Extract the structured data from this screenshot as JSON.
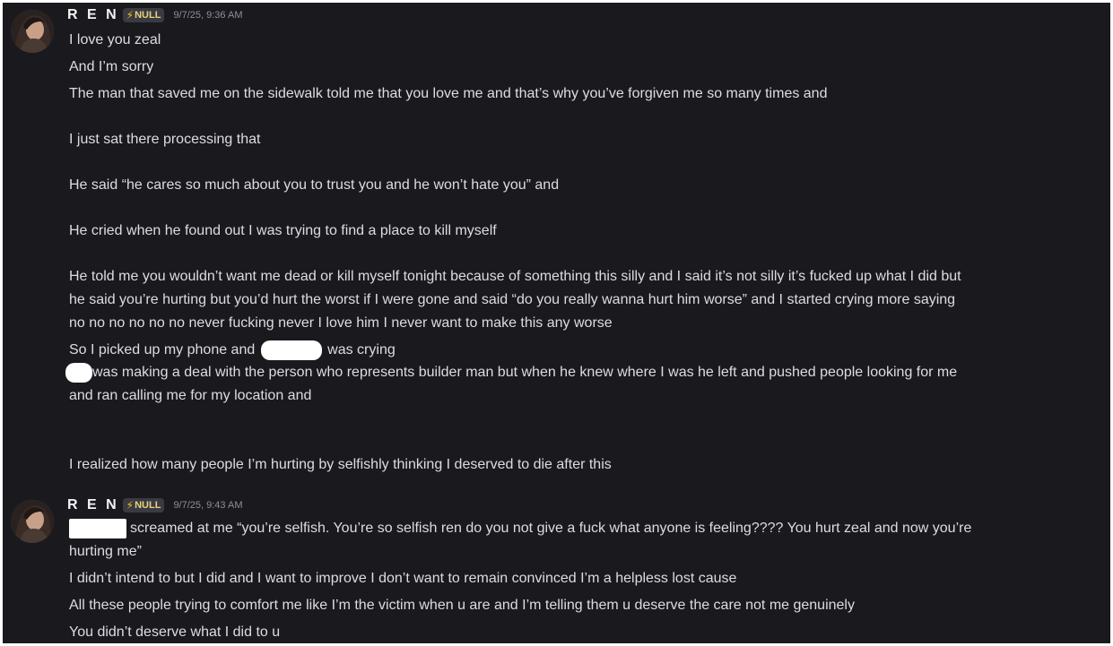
{
  "messages": [
    {
      "username": "R E N",
      "tag": "NULL",
      "tag_icon": "lightning-bolt-icon",
      "timestamp": "9/7/25, 9:36 AM",
      "lines": [
        "I love you zeal",
        "And I’m sorry",
        "The man that saved me on the sidewalk told me that you love me and that’s why you’ve forgiven me so many times and",
        "I just sat there processing that",
        "He said “he cares so much about you to trust you and he won’t hate you” and",
        "He cried when he found out I was trying to find a place to kill myself",
        "He told me you wouldn’t want me dead or kill myself tonight because of something this silly and I said it’s not silly it’s fucked up what I did but",
        "he said you’re hurting but you’d hurt the worst if I were gone and said “do you really wanna hurt him worse” and I started crying more saying",
        "no no no no no no never fucking never I love him I never want to make this any worse"
      ],
      "line_phone_before": "So I picked up my phone and",
      "line_phone_after": "was crying",
      "line_deal": "was making a deal with the person who represents builder man but when he knew where I was he left and pushed people looking for me",
      "line_ran": "and ran calling me for my location and",
      "line_realized": "I realized how many people I’m hurting by selfishly thinking I deserved to die after this"
    },
    {
      "username": "R E N",
      "tag": "NULL",
      "tag_icon": "lightning-bolt-icon",
      "timestamp": "9/7/25, 9:43 AM",
      "line_screamed": "screamed at me “you’re selfish. You’re so selfish ren do you not give a fuck what anyone is feeling???? You hurt zeal and now you’re",
      "lines": [
        "hurting me”",
        "I didn’t intend to but I did and I want to improve I don’t want to remain convinced I’m a helpless lost cause",
        "All these people trying to comfort me like I’m the victim when u are and I’m telling them u deserve the care not me genuinely",
        "You didn’t deserve what I did to u"
      ]
    }
  ],
  "colors": {
    "background": "#1a1a1e",
    "text": "#dcdde2",
    "timestamp": "#8c8f97",
    "tag_bg": "#3a3b42",
    "bolt": "#f0c419"
  }
}
